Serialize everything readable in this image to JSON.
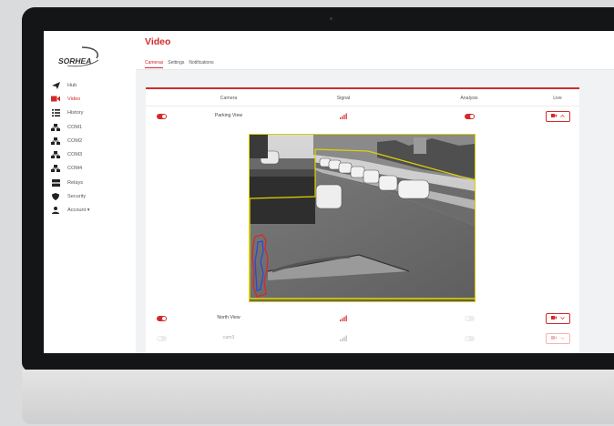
{
  "app": {
    "logo_text": "SORHEA"
  },
  "sidebar": {
    "items": [
      {
        "label": "Hub",
        "icon": "send-icon",
        "active": false
      },
      {
        "label": "Video",
        "icon": "video-camera-icon",
        "active": true
      },
      {
        "label": "History",
        "icon": "list-icon",
        "active": false
      },
      {
        "label": "COM1",
        "icon": "network-icon",
        "active": false
      },
      {
        "label": "COM2",
        "icon": "network-icon",
        "active": false
      },
      {
        "label": "COM3",
        "icon": "network-icon",
        "active": false
      },
      {
        "label": "COM4",
        "icon": "network-icon",
        "active": false
      },
      {
        "label": "Relays",
        "icon": "relay-icon",
        "active": false
      },
      {
        "label": "Security",
        "icon": "shield-icon",
        "active": false
      },
      {
        "label": "Account ▾",
        "icon": "user-icon",
        "active": false
      }
    ]
  },
  "page": {
    "title": "Video",
    "tabs": [
      {
        "label": "Cameras",
        "active": true
      },
      {
        "label": "Settings",
        "active": false
      },
      {
        "label": "Notifications",
        "active": false
      }
    ]
  },
  "table": {
    "headers": [
      "Camera",
      "Signal",
      "Analysis",
      "Live"
    ],
    "rows": [
      {
        "name": "Parking View",
        "enabled": true,
        "analysis": true,
        "expanded": true
      },
      {
        "name": "North View",
        "enabled": true,
        "analysis": false,
        "expanded": false
      },
      {
        "name": "cam3",
        "enabled": false,
        "analysis": false,
        "expanded": false
      }
    ]
  },
  "colors": {
    "accent": "#d42a2a",
    "detection_zone": "#d9d000"
  }
}
